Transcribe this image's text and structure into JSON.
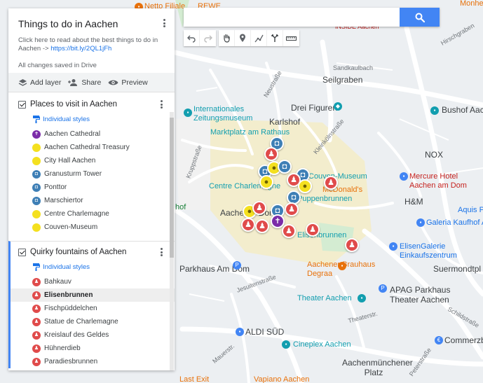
{
  "panel": {
    "title": "Things to do in Aachen",
    "description_prefix": "Click here to read about the best things to do in Aachen -> ",
    "description_link": "https://bit.ly/2QL1jFh",
    "save_status": "All changes saved in Drive",
    "actions": {
      "add_layer": "Add layer",
      "share": "Share",
      "preview": "Preview"
    }
  },
  "layers": [
    {
      "title": "Places to visit in Aachen",
      "style_label": "Individual styles",
      "items": [
        {
          "label": "Aachen Cathedral",
          "marker": "purple",
          "icon": "cross-icon"
        },
        {
          "label": "Aachen Cathedral Treasury",
          "marker": "yellow",
          "icon": "circle-icon"
        },
        {
          "label": "City Hall Aachen",
          "marker": "yellow",
          "icon": "circle-icon"
        },
        {
          "label": "Granusturm Tower",
          "marker": "blue",
          "icon": "camera-icon"
        },
        {
          "label": "Ponttor",
          "marker": "blue",
          "icon": "camera-icon"
        },
        {
          "label": "Marschiertor",
          "marker": "blue",
          "icon": "camera-icon"
        },
        {
          "label": "Centre Charlemagne",
          "marker": "yellow",
          "icon": "circle-icon"
        },
        {
          "label": "Couven-Museum",
          "marker": "yellow",
          "icon": "circle-icon"
        }
      ]
    },
    {
      "title": "Quirky fountains of Aachen",
      "style_label": "Individual styles",
      "items": [
        {
          "label": "Bahkauv",
          "marker": "red",
          "icon": "person-icon"
        },
        {
          "label": "Elisenbrunnen",
          "marker": "red",
          "icon": "person-icon",
          "selected": true
        },
        {
          "label": "Fischpüddelchen",
          "marker": "red",
          "icon": "person-icon"
        },
        {
          "label": "Statue de Charlemagne",
          "marker": "red",
          "icon": "person-icon"
        },
        {
          "label": "Kreislauf des Geldes",
          "marker": "red",
          "icon": "person-icon"
        },
        {
          "label": "Hühnerdieb",
          "marker": "red",
          "icon": "person-icon"
        },
        {
          "label": "Paradiesbrunnen",
          "marker": "red",
          "icon": "person-icon"
        }
      ]
    }
  ],
  "search": {
    "value": "",
    "placeholder": ""
  },
  "map_labels": {
    "netto": "Netto Filiale",
    "rewe": "REWE",
    "monheims": "Monheims",
    "hirschgraben": "Hirschgraben",
    "inside_aachen": "INSIDE Aachen",
    "sandkaulbach": "Sandkaulbach",
    "seilgraben": "Seilgraben",
    "neustrasse": "Neustraße",
    "karlshof": "Karlshof",
    "drei_figuren": "Drei Figuren",
    "bushof": "Bushof Aachen",
    "zeitungsmuseum": "Internationales Zeitungsmuseum",
    "marktplatz": "Marktplatz am Rathaus",
    "kleinkolnstrasse": "Kleinkölnstraße",
    "couven": "Couven-Museum",
    "mercure": "Mercure Hotel Aachen am Dom",
    "nox": "NOX",
    "centre_charlemagne": "Centre Charlemagne",
    "mcdonalds": "McDonald's",
    "puppenbrunnen": "Puppenbrunnen",
    "hm": "H&M",
    "aquis": "Aquis P",
    "galeria": "Galeria Kaufhof A",
    "aachener_dom": "Aachener Dom",
    "elisenbrunnen": "Elisenbrunnen",
    "elisengalerie": "ElisenGalerie Einkaufszentrum",
    "parkhaus_dom": "Parkhaus Am Dom",
    "aachener_brauhaus": "Aachener Brauhaus Degraa",
    "suermondt": "Suermondtpl",
    "jesuitenstrasse": "Jesuitenstraße",
    "apag": "APAG Parkhaus Theater Aachen",
    "theater": "Theater Aachen",
    "theaterstrasse": "Theaterstr.",
    "aldi": "ALDI SÜD",
    "commerzbank": "Commerzba",
    "cineplex": "Cineplex Aachen",
    "aachenmunchener": "Aachenmünchener Platz",
    "last_exit": "Last Exit",
    "vapiano": "Vapiano Aachen",
    "hof": "hof",
    "schildstrasse": "Schildstraße",
    "kruppstrasse": "Kruppstraße",
    "peterstrasse": "Peterstraße",
    "mauerstr": "Mauerstr."
  },
  "colors": {
    "accent": "#4285f4",
    "marker_red": "#e04b4b",
    "marker_yellow": "#f4e01f",
    "marker_purple": "#7b2ca8",
    "marker_blue": "#3e7fb6"
  }
}
